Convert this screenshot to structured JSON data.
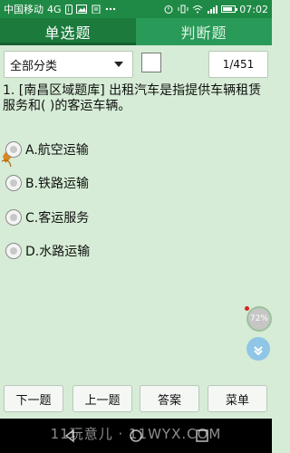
{
  "status_bar": {
    "carrier": "中国移动",
    "network": "4G",
    "carrier_badge": "i",
    "time": "07:02",
    "battery_level": 0.85
  },
  "tabs": [
    {
      "label": "单选题",
      "active": true
    },
    {
      "label": "判断题",
      "active": false
    }
  ],
  "toolbar": {
    "category": "全部分类",
    "page_counter": "1/451"
  },
  "question": {
    "text": "1. [南昌区域题库] 出租汽车是指提供车辆租赁服务和( )的客运车辆。"
  },
  "options": [
    {
      "label": "A.航空运输"
    },
    {
      "label": "B.铁路运输"
    },
    {
      "label": "C.客运服务"
    },
    {
      "label": "D.水路运输"
    }
  ],
  "floating": {
    "progress": "72%"
  },
  "bottom_buttons": {
    "next": "下一题",
    "prev": "上一题",
    "answer": "答案",
    "menu": "菜单"
  },
  "watermark": "11玩意儿 · 11WYX.COM",
  "colors": {
    "status_bar": "#1f8a45",
    "tab_active": "#1b7a3c",
    "tab_inactive": "#2a9a58",
    "background": "#d6ecd6"
  }
}
